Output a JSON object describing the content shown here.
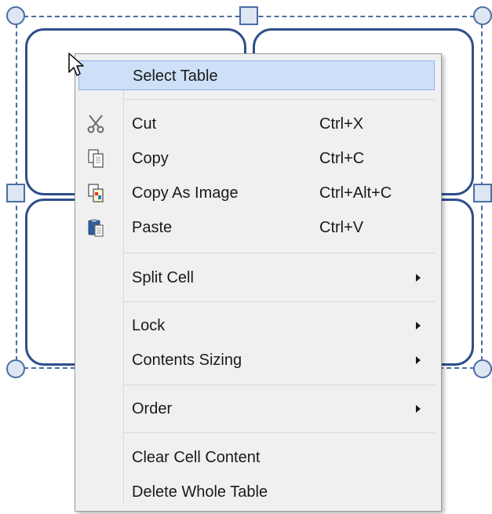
{
  "menu": {
    "select_table": "Select Table",
    "cut": {
      "label": "Cut",
      "shortcut": "Ctrl+X",
      "icon": "scissors-icon"
    },
    "copy": {
      "label": "Copy",
      "shortcut": "Ctrl+C",
      "icon": "copy-icon"
    },
    "copy_as_image": {
      "label": "Copy As Image",
      "shortcut": "Ctrl+Alt+C",
      "icon": "copy-image-icon"
    },
    "paste": {
      "label": "Paste",
      "shortcut": "Ctrl+V",
      "icon": "paste-icon"
    },
    "split_cell": "Split Cell",
    "lock": "Lock",
    "contents_sizing": "Contents Sizing",
    "order": "Order",
    "clear_cell_content": "Clear Cell Content",
    "delete_whole_table": "Delete Whole Table"
  },
  "colors": {
    "highlight": "#cde0f7",
    "menu_background": "#f0f0f0",
    "table_border": "#2f4f8a",
    "selection": "#4a6ea3"
  }
}
